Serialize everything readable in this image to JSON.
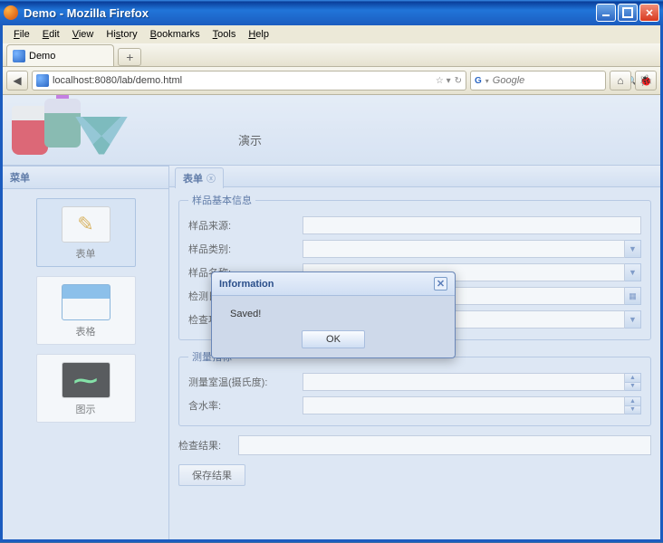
{
  "window": {
    "title": "Demo - Mozilla Firefox"
  },
  "menubar": [
    "File",
    "Edit",
    "View",
    "History",
    "Bookmarks",
    "Tools",
    "Help"
  ],
  "browser_tab": {
    "label": "Demo"
  },
  "url": "localhost:8080/lab/demo.html",
  "search": {
    "engine_initial": "G",
    "placeholder": "Google"
  },
  "page": {
    "title": "演示"
  },
  "sidebar": {
    "title": "菜单",
    "items": [
      {
        "label": "表单"
      },
      {
        "label": "表格"
      },
      {
        "label": "图示"
      }
    ]
  },
  "tabpanel": {
    "active_tab": "表单"
  },
  "fieldset1": {
    "legend": "样品基本信息",
    "rows": [
      {
        "label": "样品来源:"
      },
      {
        "label": "样品类别:"
      },
      {
        "label": "样品名称:"
      },
      {
        "label": "检测日期:"
      },
      {
        "label": "检查项目:"
      }
    ]
  },
  "fieldset2": {
    "legend": "测量指标",
    "rows": [
      {
        "label": "测量室温(摄氏度):"
      },
      {
        "label": "含水率:"
      }
    ]
  },
  "result_label": "检查结果:",
  "save_button": "保存结果",
  "dialog": {
    "title": "Information",
    "message": "Saved!",
    "ok": "OK"
  }
}
